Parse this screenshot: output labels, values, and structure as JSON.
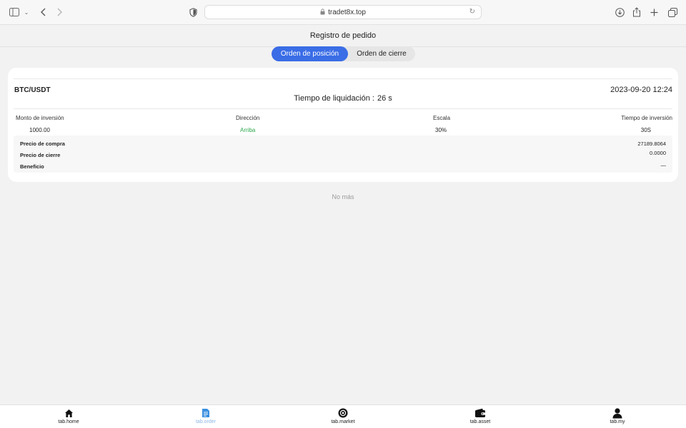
{
  "browser": {
    "url": "tradet8x.top"
  },
  "page": {
    "title": "Registro de pedido",
    "tabs": [
      {
        "label": "Orden de posición",
        "active": true
      },
      {
        "label": "Orden de cierre",
        "active": false
      }
    ]
  },
  "order": {
    "pair": "BTC/USDT",
    "datetime": "2023-09-20 12:24",
    "countdown_label": "Tiempo de liquidación :",
    "countdown_value": "26 s",
    "columns": {
      "amount": {
        "header": "Monto de inversión",
        "value": "1000.00"
      },
      "direction": {
        "header": "Dirección",
        "value": "Arriba"
      },
      "scale": {
        "header": "Escala",
        "value": "30%"
      },
      "time": {
        "header": "Tiempo de inversión",
        "value": "30S"
      }
    },
    "details": {
      "buy_price": {
        "label": "Precio de compra",
        "value": "27189.8064"
      },
      "close_price": {
        "label": "Precio de cierre",
        "value": "0.0000"
      },
      "profit": {
        "label": "Beneficio",
        "value": "—"
      }
    }
  },
  "footer_note": "No más",
  "tabbar": [
    {
      "label": "tab.home",
      "icon": "home-icon",
      "active": false
    },
    {
      "label": "tab.order",
      "icon": "document-icon",
      "active": true
    },
    {
      "label": "tab.market",
      "icon": "market-icon",
      "active": false
    },
    {
      "label": "tab.asset",
      "icon": "wallet-icon",
      "active": false
    },
    {
      "label": "tab.my",
      "icon": "person-icon",
      "active": false
    }
  ],
  "colors": {
    "accent": "#3a6de6",
    "up": "#2ea84a",
    "active_tab_label": "#8fb6e6"
  }
}
